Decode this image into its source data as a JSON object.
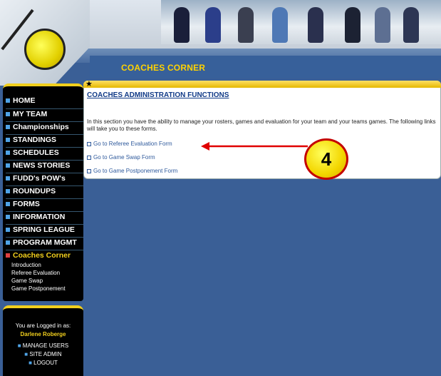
{
  "header": {
    "section_title": "COACHES CORNER",
    "star": "★"
  },
  "sidebar": {
    "items": [
      {
        "label": "HOME"
      },
      {
        "label": "MY TEAM"
      },
      {
        "label": "Championships"
      },
      {
        "label": "STANDINGS"
      },
      {
        "label": "SCHEDULES"
      },
      {
        "label": "NEWS STORIES"
      },
      {
        "label": "FUDD's POW's"
      },
      {
        "label": "ROUNDUPS"
      },
      {
        "label": "FORMS"
      },
      {
        "label": "INFORMATION"
      },
      {
        "label": "SPRING LEAGUE"
      },
      {
        "label": "PROGRAM MGMT"
      },
      {
        "label": "Coaches Corner"
      }
    ],
    "sub_items": [
      {
        "label": "Introduction"
      },
      {
        "label": "Referee Evaluation"
      },
      {
        "label": "Game Swap"
      },
      {
        "label": "Game Postponement"
      }
    ]
  },
  "user": {
    "logged_in_label": "You are Logged in as:",
    "name": "Darlene Roberge",
    "links": [
      {
        "label": "MANAGE USERS"
      },
      {
        "label": "SITE ADMIN"
      },
      {
        "label": "LOGOUT"
      }
    ]
  },
  "main": {
    "heading": "COACHES ADMINISTRATION FUNCTIONS",
    "intro": "In this section you have the ability to manage your rosters, games and evaluation for your team and your teams games.  The following links will take you to these forms.",
    "links": [
      {
        "label": "Go to Referee Evaluation Form"
      },
      {
        "label": "Go to Game Swap Form"
      },
      {
        "label": "Go to Game Postponement Form"
      }
    ]
  },
  "callout": {
    "number": "4",
    "color": "#e00000"
  },
  "colors": {
    "accent": "#f1cf1d",
    "link": "#2f5a9c",
    "background": "#3a5f96"
  }
}
